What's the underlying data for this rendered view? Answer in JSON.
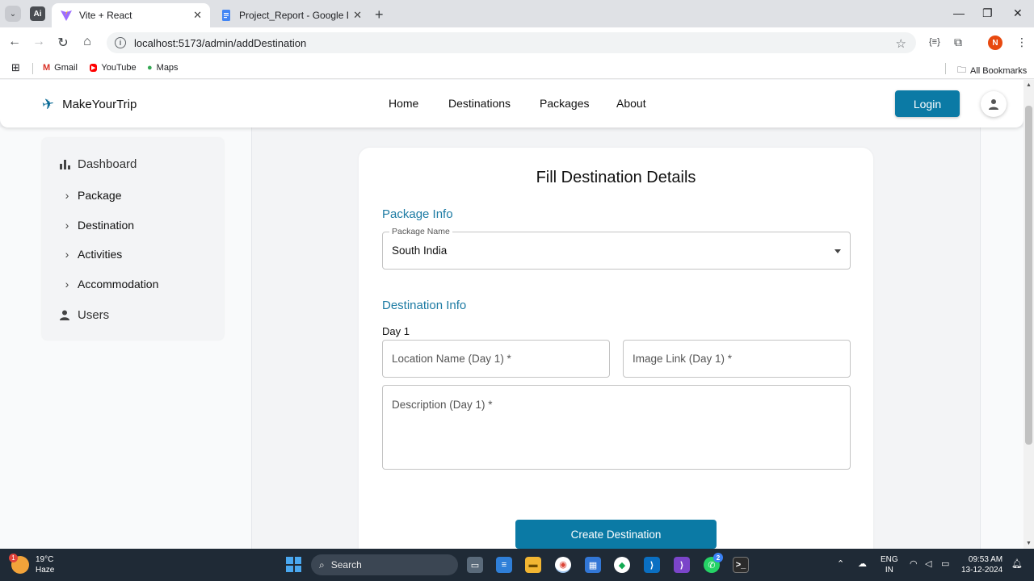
{
  "browser": {
    "tabs": [
      {
        "title": "Vite + React",
        "active": true
      },
      {
        "title": "Project_Report - Google Docs",
        "active": false
      }
    ],
    "ai_label": "Ai",
    "url": "localhost:5173/admin/addDestination",
    "profile_initial": "N",
    "bookmarks": [
      {
        "label": "Gmail"
      },
      {
        "label": "YouTube"
      },
      {
        "label": "Maps"
      }
    ],
    "all_bookmarks": "All Bookmarks"
  },
  "header": {
    "brand": "MakeYourTrip",
    "nav": [
      "Home",
      "Destinations",
      "Packages",
      "About"
    ],
    "login": "Login"
  },
  "sidebar": {
    "dashboard": "Dashboard",
    "items": [
      "Package",
      "Destination",
      "Activities",
      "Accommodation"
    ],
    "users": "Users"
  },
  "form": {
    "title": "Fill Destination Details",
    "package_section": "Package Info",
    "package_label": "Package Name",
    "package_value": "South India",
    "destination_section": "Destination Info",
    "day_label": "Day 1",
    "location_placeholder": "Location Name (Day 1) *",
    "image_placeholder": "Image Link (Day 1) *",
    "description_placeholder": "Description (Day 1) *",
    "submit": "Create Destination"
  },
  "taskbar": {
    "weather_temp": "19°C",
    "weather_desc": "Haze",
    "weather_badge": "1",
    "search": "Search",
    "whatsapp_badge": "2",
    "lang_1": "ENG",
    "lang_2": "IN",
    "time": "09:53 AM",
    "date": "13-12-2024"
  },
  "colors": {
    "primary": "#0b7aa5",
    "section_heading": "#1b7aa3"
  }
}
